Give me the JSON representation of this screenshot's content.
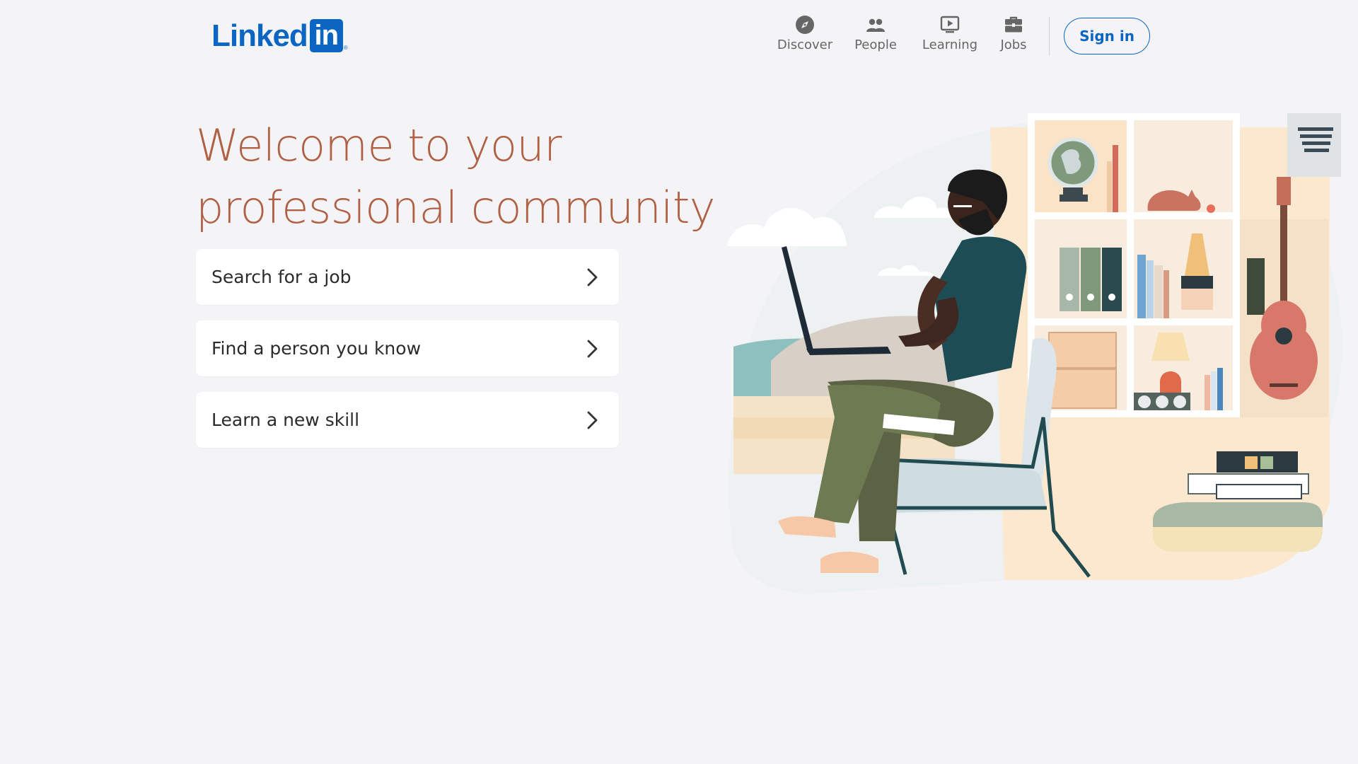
{
  "brand": {
    "word": "Linked",
    "box": "in",
    "reg": "®"
  },
  "nav": [
    {
      "label": "Discover",
      "icon": "compass-icon"
    },
    {
      "label": "People",
      "icon": "people-icon"
    },
    {
      "label": "Learning",
      "icon": "play-icon"
    },
    {
      "label": "Jobs",
      "icon": "briefcase-icon"
    }
  ],
  "signin_label": "Sign in",
  "headline": {
    "line1": "Welcome to your",
    "line2": "professional community"
  },
  "actions": [
    {
      "label": "Search for a job"
    },
    {
      "label": "Find a person you know"
    },
    {
      "label": "Learn a new skill"
    }
  ],
  "colors": {
    "brand_blue": "#0a66c2",
    "headline": "#b06045",
    "background": "#f4f4f6"
  }
}
